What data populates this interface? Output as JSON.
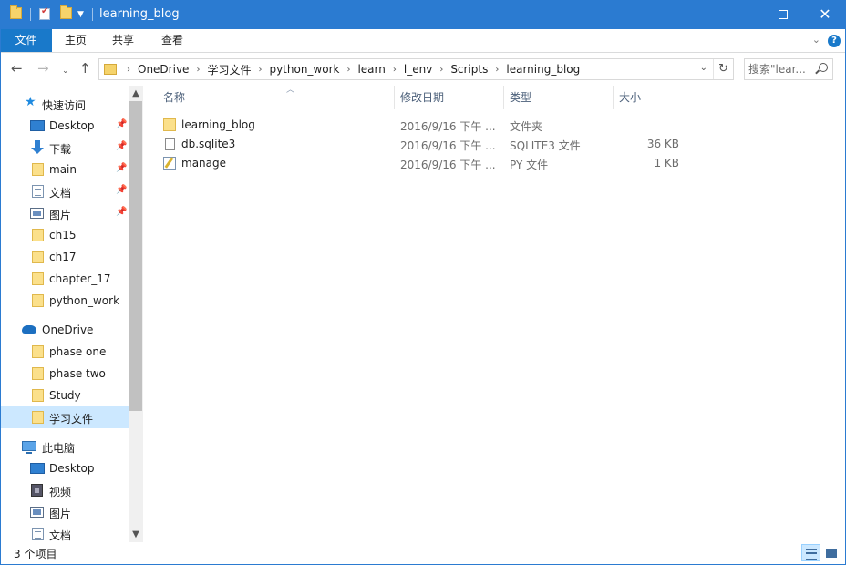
{
  "window": {
    "title": "learning_blog",
    "border_color": "#2b7bd1"
  },
  "ribbon": {
    "tabs": [
      "文件",
      "主页",
      "共享",
      "查看"
    ],
    "active_tab": "文件",
    "accent": "#1979ca",
    "help_label": "?"
  },
  "address": {
    "breadcrumbs": [
      "OneDrive",
      "学习文件",
      "python_work",
      "learn",
      "l_env",
      "Scripts",
      "learning_blog"
    ]
  },
  "search": {
    "placeholder": "搜索\"lear..."
  },
  "nav_pane": {
    "quick_access": {
      "label": "快速访问",
      "items": [
        {
          "label": "Desktop",
          "icon": "desktop-icon",
          "pinned": true
        },
        {
          "label": "下载",
          "icon": "download-icon",
          "pinned": true
        },
        {
          "label": "main",
          "icon": "folder-icon",
          "pinned": true
        },
        {
          "label": "文档",
          "icon": "document-icon",
          "pinned": true
        },
        {
          "label": "图片",
          "icon": "pictures-icon",
          "pinned": true
        },
        {
          "label": "ch15",
          "icon": "folder-icon",
          "pinned": false
        },
        {
          "label": "ch17",
          "icon": "folder-icon",
          "pinned": false
        },
        {
          "label": "chapter_17",
          "icon": "folder-icon",
          "pinned": false
        },
        {
          "label": "python_work",
          "icon": "folder-icon",
          "pinned": false
        }
      ]
    },
    "onedrive": {
      "label": "OneDrive",
      "items": [
        {
          "label": "phase one",
          "icon": "folder-icon"
        },
        {
          "label": "phase two",
          "icon": "folder-icon"
        },
        {
          "label": "Study",
          "icon": "folder-icon"
        },
        {
          "label": "学习文件",
          "icon": "folder-icon",
          "selected": true
        }
      ]
    },
    "this_pc": {
      "label": "此电脑",
      "items": [
        {
          "label": "Desktop",
          "icon": "desktop-icon"
        },
        {
          "label": "视频",
          "icon": "video-icon"
        },
        {
          "label": "图片",
          "icon": "pictures-icon"
        },
        {
          "label": "文档",
          "icon": "document-icon"
        }
      ]
    }
  },
  "file_list": {
    "columns": [
      "名称",
      "修改日期",
      "类型",
      "大小"
    ],
    "rows": [
      {
        "name": "learning_blog",
        "modified": "2016/9/16 下午 ...",
        "type": "文件夹",
        "size": "",
        "icon": "folder-icon"
      },
      {
        "name": "db.sqlite3",
        "modified": "2016/9/16 下午 ...",
        "type": "SQLITE3 文件",
        "size": "36 KB",
        "icon": "file-icon"
      },
      {
        "name": "manage",
        "modified": "2016/9/16 下午 ...",
        "type": "PY 文件",
        "size": "1 KB",
        "icon": "python-file-icon"
      }
    ]
  },
  "status_bar": {
    "item_count": "3 个项目"
  }
}
